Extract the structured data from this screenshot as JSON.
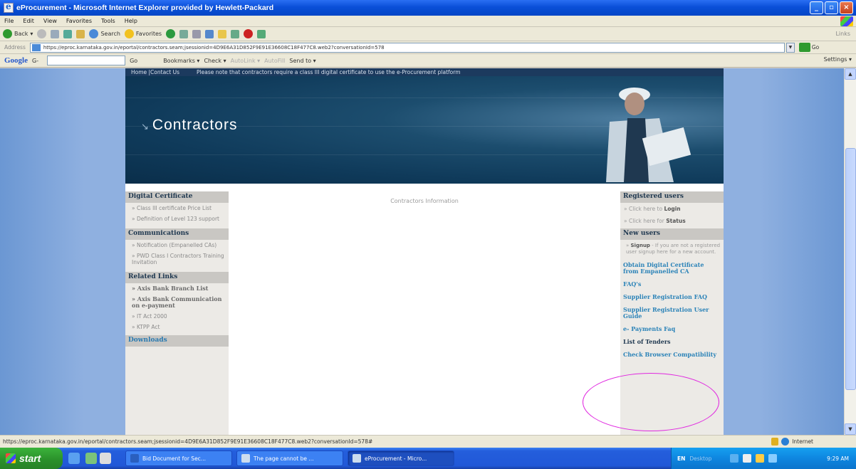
{
  "window": {
    "title": "eProcurement - Microsoft Internet Explorer provided by Hewlett-Packard",
    "buttons": [
      "_",
      "▫",
      "×"
    ]
  },
  "menu": [
    "File",
    "Edit",
    "View",
    "Favorites",
    "Tools",
    "Help"
  ],
  "toolbar": {
    "back": "Back",
    "search": "Search",
    "favorites": "Favorites",
    "links": "Links"
  },
  "address": {
    "label": "Address",
    "url": "https://eproc.karnataka.gov.in/eportal/contractors.seam;jsessionid=4D9E6A31D852F9E91E36608C18F477C8.web2?conversationId=578",
    "go": "Go"
  },
  "googlebar": {
    "logo": "Google",
    "g_label": "G-",
    "go": "Go",
    "bookmarks": "Bookmarks ▾",
    "check": "Check ▾",
    "autolink": "AutoLink ▾",
    "autofill": "AutoFill",
    "send_to": "Send to ▾",
    "settings": "Settings ▾"
  },
  "site": {
    "top_nav": "Home |Contact Us",
    "notice": "Please note that contractors require a class III digital certificate to use the e-Procurement platform",
    "banner_title": "Contractors",
    "center_info": "Contractors Information",
    "left": {
      "digital_certificate": {
        "heading": "Digital Certificate",
        "items": [
          "» Class III certificate Price List",
          "» Definition of Level 123 support"
        ]
      },
      "communications": {
        "heading": "Communications",
        "items": [
          "» Notification (Empanelled CAs)",
          "» PWD Class I Contractors Training Invitation"
        ]
      },
      "related_links": {
        "heading": "Related Links",
        "items": [
          "» Axis Bank Branch List",
          "» Axis Bank Communication on e-payment",
          "» IT Act 2000",
          "» KTPP Act"
        ]
      },
      "downloads": {
        "heading": "Downloads"
      }
    },
    "right": {
      "registered_heading": "Registered users",
      "login_prefix": "» Click here to ",
      "login_bold": "Login",
      "status_prefix": "» Click here for ",
      "status_bold": "Status",
      "new_users_heading": "New users",
      "signup_bold": "Signup",
      "signup_text": " - If you are not a registered user signup here for a new account.",
      "links": [
        "Obtain Digital Certificate from Empanelled CA",
        "FAQ's",
        "Supplier Registration FAQ",
        "Supplier Registration User Guide",
        "e- Payments Faq"
      ],
      "list_of_tenders": "List of Tenders",
      "check_browser": "Check Browser Compatibility"
    }
  },
  "status": {
    "url": "https://eproc.karnataka.gov.in/eportal/contractors.seam;jsessionid=4D9E6A31D852F9E91E36608C18F477C8.web2?conversationId=578#",
    "zone": "Internet"
  },
  "taskbar": {
    "start": "start",
    "tasks": [
      "Bid Document for Sec...",
      "The page cannot be ...",
      "eProcurement - Micro..."
    ],
    "lang": "EN",
    "desktop": "Desktop",
    "clock": "9:29 AM"
  }
}
